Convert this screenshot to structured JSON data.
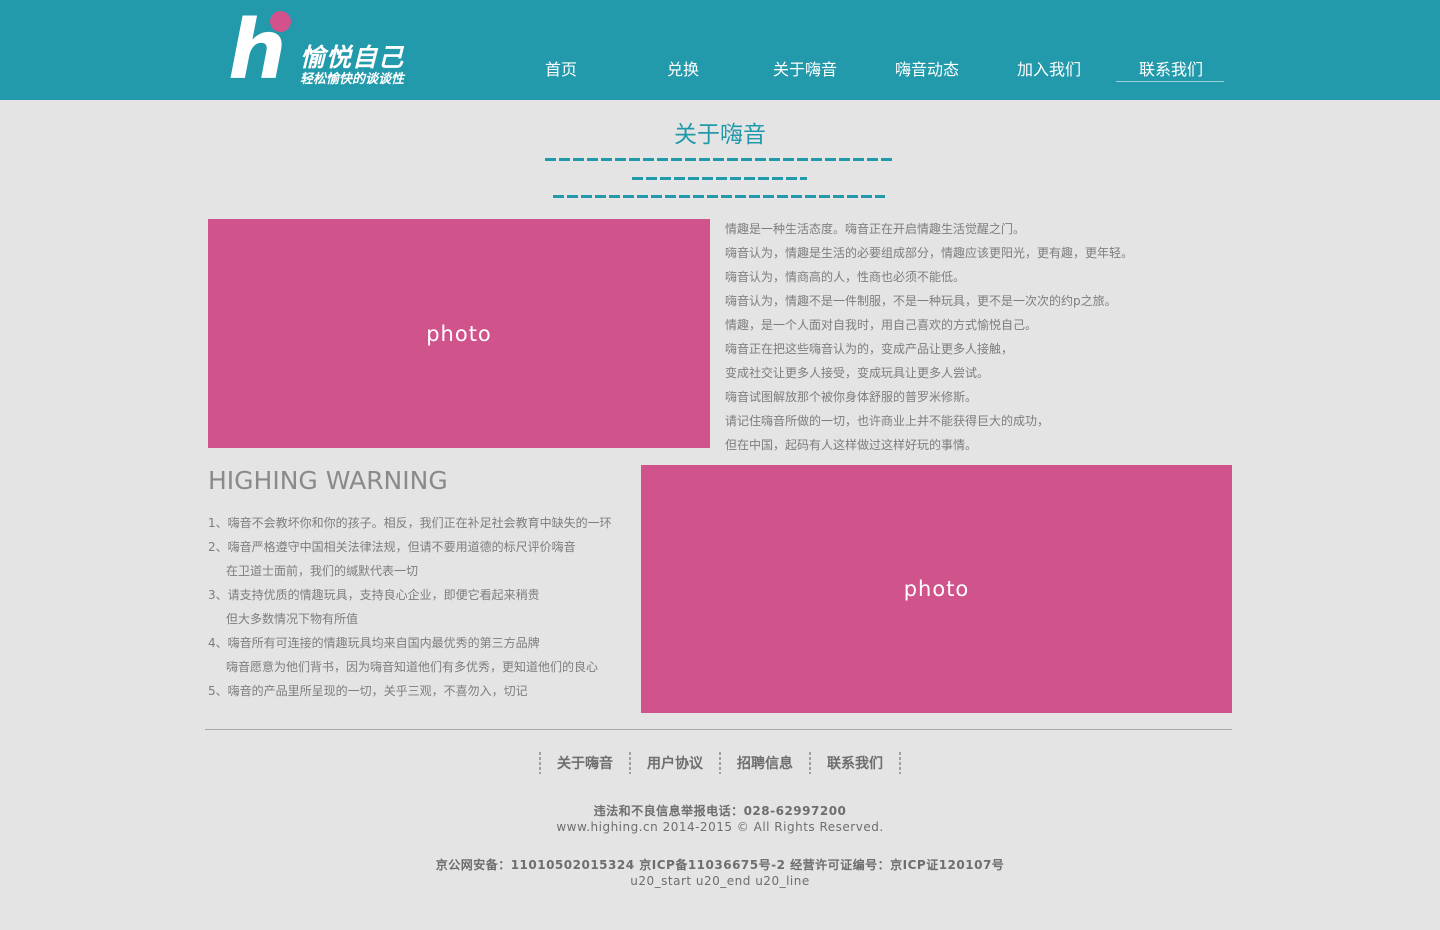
{
  "brand": {
    "logo_letter": "h",
    "name": "愉悦自己",
    "slogan": "轻松愉快的谈谈性",
    "accent_color": "#229aab",
    "dot_color": "#d3528b"
  },
  "nav": {
    "items": [
      {
        "label": "首页"
      },
      {
        "label": "兑换"
      },
      {
        "label": "关于嗨音"
      },
      {
        "label": "嗨音动态"
      },
      {
        "label": "加入我们"
      },
      {
        "label": "联系我们",
        "active": true
      }
    ]
  },
  "about": {
    "title": "关于嗨音",
    "photo_label": "photo",
    "lines": [
      "情趣是一种生活态度。嗨音正在开启情趣生活觉醒之门。",
      "嗨音认为，情趣是生活的必要组成部分，情趣应该更阳光，更有趣，更年轻。",
      "嗨音认为，情商高的人，性商也必须不能低。",
      "嗨音认为，情趣不是一件制服，不是一种玩具，更不是一次次的约p之旅。",
      "情趣，是一个人面对自我时，用自己喜欢的方式愉悦自己。",
      "嗨音正在把这些嗨音认为的，变成产品让更多人接触，",
      "变成社交让更多人接受，变成玩具让更多人尝试。",
      "嗨音试图解放那个被你身体舒服的普罗米修斯。",
      "请记住嗨音所做的一切，也许商业上并不能获得巨大的成功，",
      "但在中国，起码有人这样做过这样好玩的事情。"
    ]
  },
  "warning": {
    "title": "HIGHING WARNING",
    "photo_label": "photo",
    "lines": [
      {
        "text": "1、嗨音不会教坏你和你的孩子。相反，我们正在补足社会教育中缺失的一环",
        "indent": false
      },
      {
        "text": "2、嗨音严格遵守中国相关法律法规，但请不要用道德的标尺评价嗨音",
        "indent": false
      },
      {
        "text": "在卫道士面前，我们的缄默代表一切",
        "indent": true
      },
      {
        "text": "3、请支持优质的情趣玩具，支持良心企业，即便它看起来稍贵",
        "indent": false
      },
      {
        "text": "但大多数情况下物有所值",
        "indent": true
      },
      {
        "text": "4、嗨音所有可连接的情趣玩具均来自国内最优秀的第三方品牌",
        "indent": false
      },
      {
        "text": "嗨音愿意为他们背书，因为嗨音知道他们有多优秀，更知道他们的良心",
        "indent": true
      },
      {
        "text": "5、嗨音的产品里所呈现的一切，关乎三观，不喜勿入，切记",
        "indent": false
      }
    ]
  },
  "footer": {
    "links": [
      "关于嗨音",
      "用户协议",
      "招聘信息",
      "联系我们"
    ],
    "hotline": "违法和不良信息举报电话：028-62997200",
    "copyright": "www.highing.cn 2014-2015 © All Rights Reserved.",
    "license": "京公网安备：11010502015324 京ICP备11036675号-2 经营许可证编号：京ICP证120107号",
    "debug": "u20_start u20_end u20_line"
  },
  "colors": {
    "header_bg": "#229aab",
    "page_bg": "#e4e4e4",
    "photo_bg": "#d0538c"
  }
}
